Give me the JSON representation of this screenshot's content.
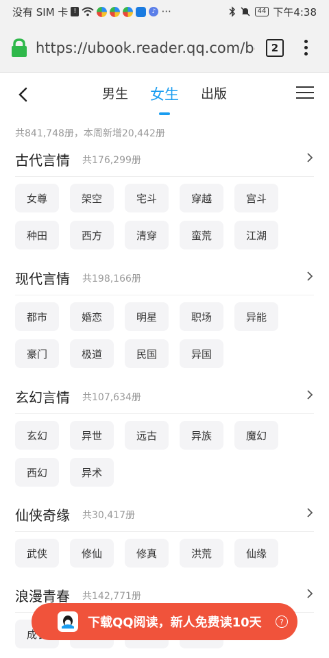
{
  "status_bar": {
    "carrier": "没有 SIM 卡",
    "more": "···",
    "battery": "44",
    "time": "下午4:38"
  },
  "browser": {
    "url": "https://ubook.reader.qq.com/boo",
    "tab_count": "2"
  },
  "nav": {
    "tabs": [
      "男生",
      "女生",
      "出版"
    ],
    "active_tab": "女生"
  },
  "summary": "共841,748册，本周新增20,442册",
  "sections": [
    {
      "title": "古代言情",
      "count": "共176,299册",
      "tags": [
        "女尊",
        "架空",
        "宅斗",
        "穿越",
        "宫斗",
        "种田",
        "西方",
        "清穿",
        "蛮荒",
        "江湖"
      ]
    },
    {
      "title": "现代言情",
      "count": "共198,166册",
      "tags": [
        "都市",
        "婚恋",
        "明星",
        "职场",
        "异能",
        "豪门",
        "极道",
        "民国",
        "异国"
      ]
    },
    {
      "title": "玄幻言情",
      "count": "共107,634册",
      "tags": [
        "玄幻",
        "异世",
        "远古",
        "异族",
        "魔幻",
        "西幻",
        "异术"
      ]
    },
    {
      "title": "仙侠奇缘",
      "count": "共30,417册",
      "tags": [
        "武侠",
        "修仙",
        "修真",
        "洪荒",
        "仙缘"
      ]
    },
    {
      "title": "浪漫青春",
      "count": "共142,771册",
      "tags": [
        "成长",
        "",
        "",
        ""
      ]
    }
  ],
  "banner": {
    "text": "下载QQ阅读，新人免费读10天",
    "help": "?"
  },
  "colors": {
    "accent": "#1a9df0",
    "banner": "#f0533b",
    "lock": "#2fb84b"
  }
}
